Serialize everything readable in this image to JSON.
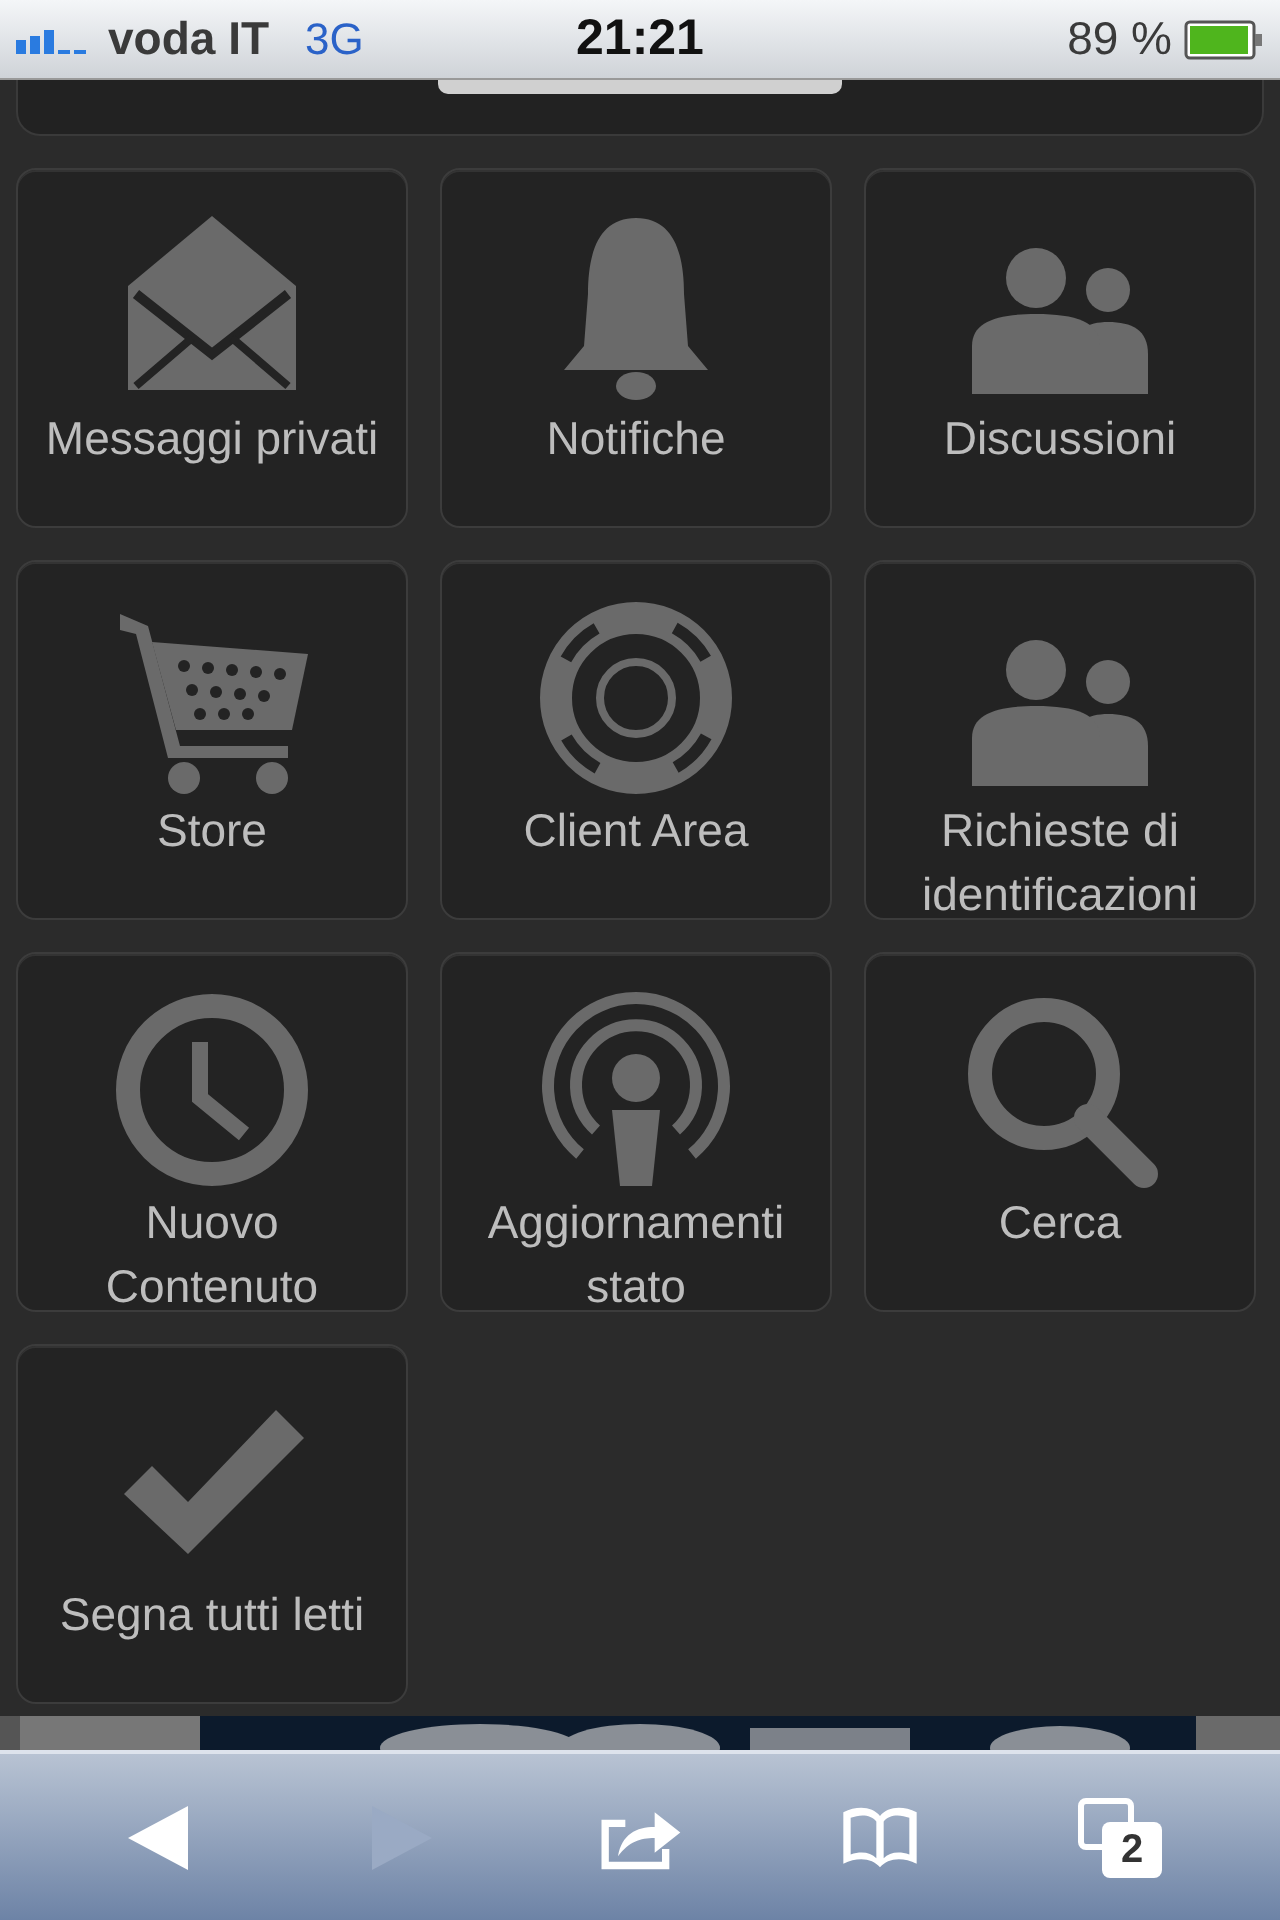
{
  "status_bar": {
    "carrier": "voda IT",
    "network": "3G",
    "time": "21:21",
    "battery": "89 %"
  },
  "menu": {
    "tiles": [
      {
        "kind": "envelope",
        "label": "Messaggi privati"
      },
      {
        "kind": "bell",
        "label": "Notifiche"
      },
      {
        "kind": "people",
        "label": "Discussioni"
      },
      {
        "kind": "cart",
        "label": "Store"
      },
      {
        "kind": "lifebuoy",
        "label": "Client Area"
      },
      {
        "kind": "people",
        "label": "Richieste di identificazioni"
      },
      {
        "kind": "clock",
        "label": "Nuovo Contenuto"
      },
      {
        "kind": "broadcast",
        "label": "Aggiornamenti stato"
      },
      {
        "kind": "search",
        "label": "Cerca"
      },
      {
        "kind": "check",
        "label": "Segna tutti letti"
      }
    ]
  },
  "toolbar": {
    "buttons": [
      {
        "kind": "back",
        "disabled": false
      },
      {
        "kind": "forward",
        "disabled": true
      },
      {
        "kind": "share",
        "disabled": false
      },
      {
        "kind": "bookmarks",
        "disabled": false
      },
      {
        "kind": "pages",
        "disabled": false,
        "count": "2"
      }
    ]
  }
}
